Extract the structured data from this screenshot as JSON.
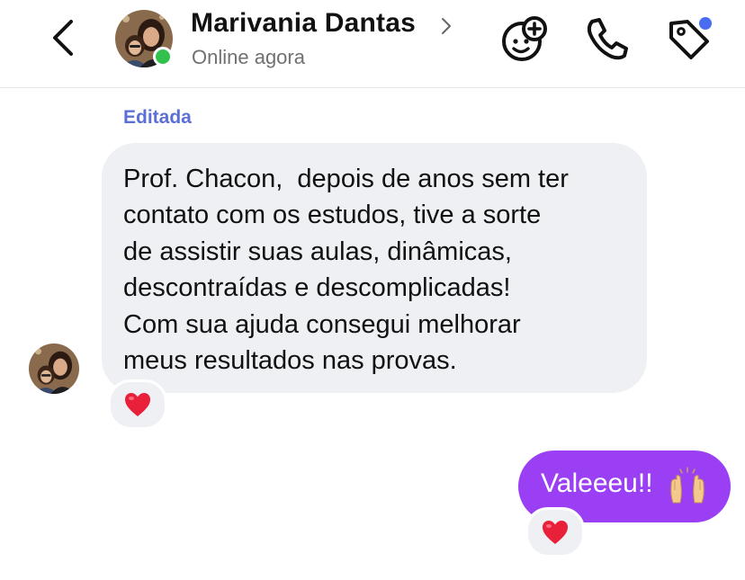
{
  "header": {
    "contact_name": "Marivania Dantas",
    "status": "Online agora",
    "icons": [
      "back-arrow-icon",
      "chevron-right-icon",
      "avatar",
      "online-dot",
      "add-person-icon",
      "phone-icon",
      "tag-icon"
    ],
    "colors": {
      "online": "#31c24d",
      "badge": "#4a6cf2"
    }
  },
  "messages": [
    {
      "direction": "incoming",
      "edited_label": "Editada",
      "text": "Prof. Chacon,  depois de anos sem ter\ncontato com os estudos, tive a sorte\nde assistir suas aulas, dinâmicas,\ndescontraídas e descomplicadas!\nCom sua ajuda consegui melhorar\nmeus resultados nas provas.",
      "reaction": "heart",
      "bubble_color": "#eef0f3"
    },
    {
      "direction": "outgoing",
      "text": "Valeeeu!!",
      "emoji": "raising-hands",
      "reaction": "heart",
      "bubble_color": "#9b3ff5"
    }
  ],
  "colors": {
    "edited_label": "#5b6fd6",
    "heart": "#e8203a"
  }
}
